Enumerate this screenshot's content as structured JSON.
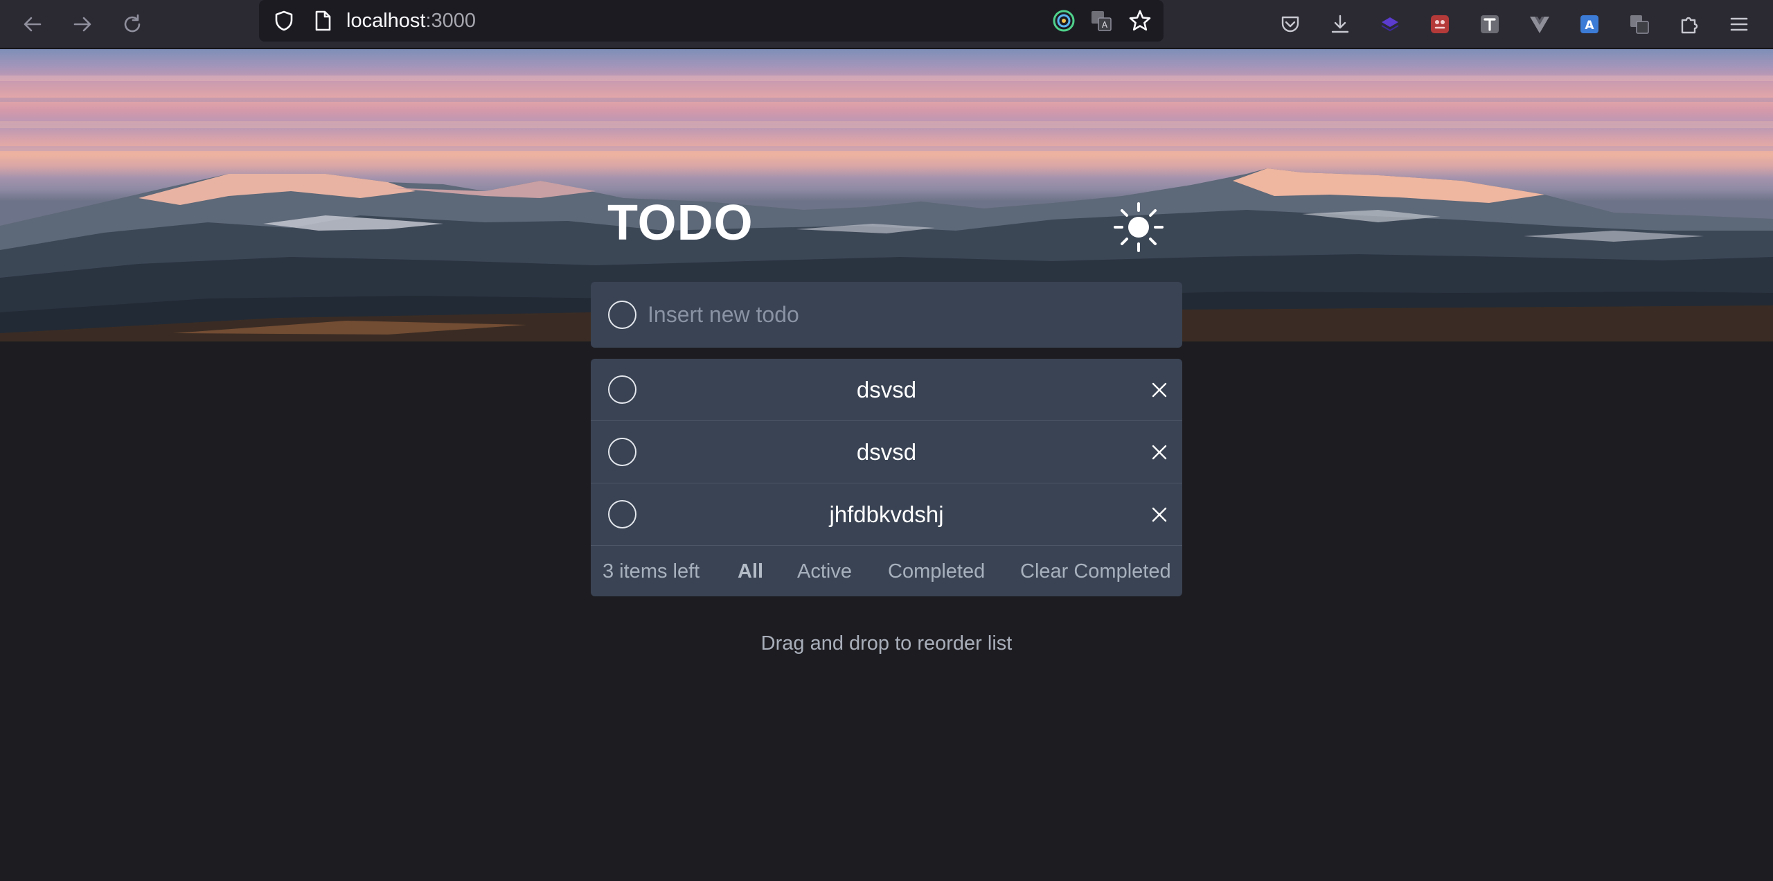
{
  "browser": {
    "url_host": "localhost",
    "url_port": ":3000",
    "icons": {
      "back": "arrow-left-icon",
      "forward": "arrow-right-icon",
      "reload": "reload-icon",
      "tracking": "shield-icon",
      "page": "page-icon",
      "extension_1": "target-icon",
      "translate": "translate-icon",
      "bookmark": "star-icon",
      "pocket": "pocket-icon",
      "downloads": "download-icon",
      "extensions": "puzzle-icon",
      "menu": "hamburger-menu-icon"
    }
  },
  "app": {
    "title": "TODO",
    "theme_toggle_icon": "sun-icon",
    "new_todo_placeholder": "Insert new todo",
    "todos": [
      {
        "text": "dsvsd",
        "completed": false
      },
      {
        "text": "dsvsd",
        "completed": false
      },
      {
        "text": "jhfdbkvdshj",
        "completed": false
      }
    ],
    "delete_icon": "close-icon",
    "footer": {
      "items_left": "3 items left",
      "filter_all": "All",
      "filter_active": "Active",
      "filter_completed": "Completed",
      "clear_completed": "Clear Completed",
      "active_filter": "All"
    },
    "hint": "Drag and drop to reorder list"
  },
  "colors": {
    "page_background": "#1d1c21",
    "card_background": "#394353",
    "text_primary": "#ffffff",
    "text_muted": "#a7b0bd"
  }
}
